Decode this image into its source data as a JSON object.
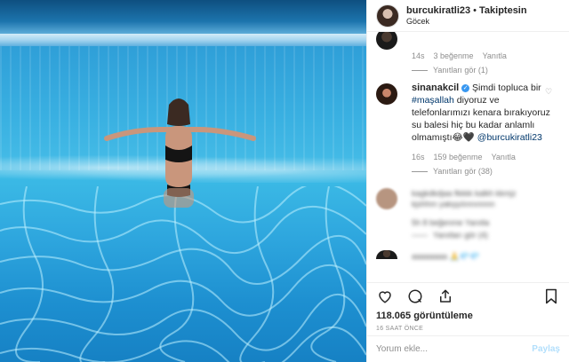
{
  "header": {
    "username": "burcukiratli23",
    "separator": "•",
    "follow_label": "Takiptesin",
    "location": "Göcek"
  },
  "comments": [
    {
      "text_blurred": true,
      "time": "14s",
      "likes": "3 beğenme",
      "reply_label": "Yanıtla",
      "view_replies": "Yanıtları gör (1)"
    },
    {
      "username": "sinanakcil",
      "text_before": "Şimdi topluca bir ",
      "hashtag": "#maşallah",
      "text_after": " diyoruz ve telefonlarımızı kenara bırakıyoruz su balesi hiç bu kadar anlamlı olmamıştı",
      "emojis": "😂🖤",
      "mention": "@burcukiratli23",
      "time": "16s",
      "likes": "159 beğenme",
      "reply_label": "Yanıtla",
      "view_replies": "Yanıtları gör (38)"
    },
    {
      "text_blurred": true,
      "blurred_line1": "kagkdkdjaa fkkkk kalkh kkmjz",
      "blurred_line2": "kjshhm yakşşılınnınnnn",
      "meta_blurred": "5h   8 beğenme   Yanıtla",
      "replies_blurred": "Yanıtları gör (4)"
    },
    {
      "text_blurred": true,
      "blurred_line1": "aaaaaaaa 🙏💎💎"
    }
  ],
  "actions": {
    "like_icon": "heart-icon",
    "comment_icon": "comment-icon",
    "share_icon": "share-icon",
    "save_icon": "bookmark-icon"
  },
  "views": "118.065 görüntüleme",
  "timestamp": "16 SAAT ÖNCE",
  "comment_box": {
    "placeholder": "Yorum ekle...",
    "post_label": "Paylaş"
  },
  "colors": {
    "link": "#00376b",
    "verified": "#3897f0",
    "muted": "#8e8e8e",
    "post_disabled": "#b2dffc"
  }
}
